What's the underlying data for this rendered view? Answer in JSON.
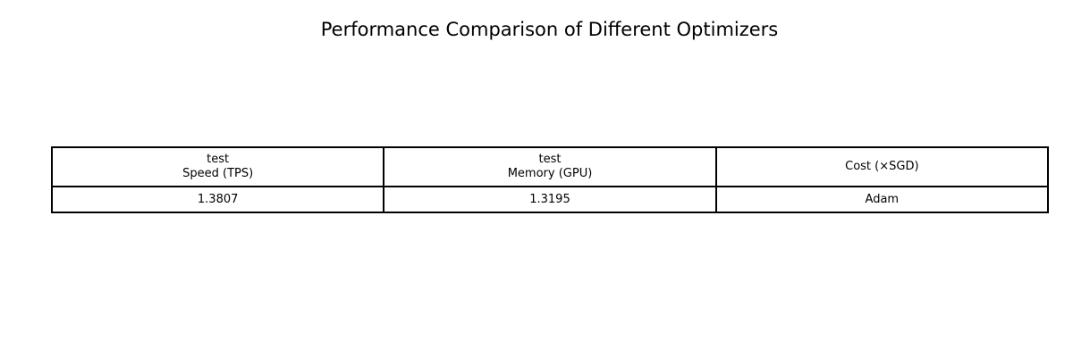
{
  "chart_data": {
    "type": "table",
    "title": "Performance Comparison of Different Optimizers",
    "columns": [
      {
        "lines": [
          "test",
          "Speed (TPS)"
        ]
      },
      {
        "lines": [
          "test",
          "Memory (GPU)"
        ]
      },
      {
        "lines": [
          "Cost (×SGD)"
        ]
      }
    ],
    "rows": [
      [
        "1.3807",
        "1.3195",
        "Adam"
      ]
    ]
  }
}
